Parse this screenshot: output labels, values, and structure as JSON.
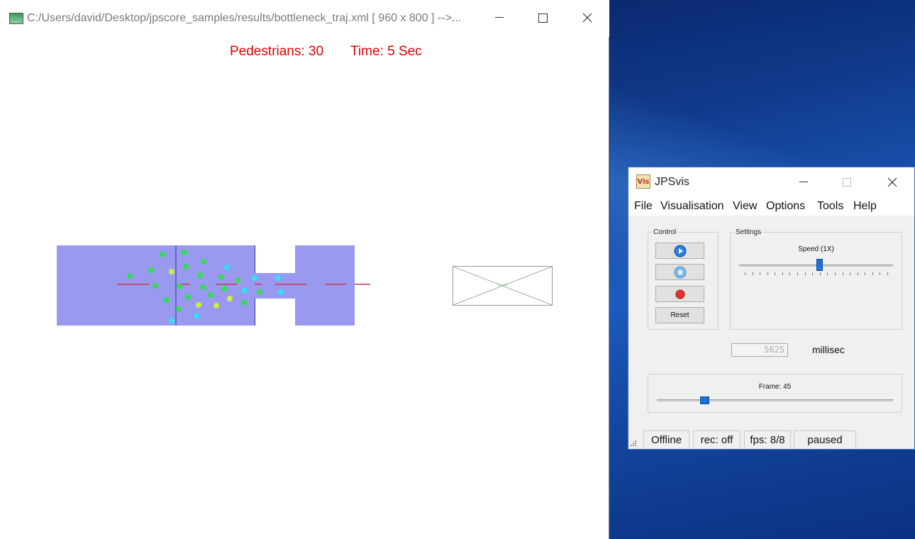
{
  "vis_window": {
    "title": "C:/Users/david/Desktop/jpscore_samples/results/bottleneck_traj.xml [ 960 x 800 ] -->...",
    "pedestrians_text": "Pedestrians: 30",
    "time_text": "Time: 5 Sec"
  },
  "jpsvis": {
    "title": "JPSvis",
    "icon_text": "Vis",
    "menu": [
      "File",
      "Visualisation",
      "View",
      "Options",
      "Tools",
      "Help"
    ],
    "control_label": "Control",
    "settings_label": "Settings",
    "speed_label": "Speed (1X)",
    "speed_position": 0.52,
    "reset_label": "Reset",
    "lcd_value": "5625",
    "lcd_unit": "millisec",
    "frame_label": "Frame: 45",
    "frame_position": 0.2,
    "status": [
      "Offline",
      "rec: off",
      "fps: 8/8",
      "paused"
    ]
  },
  "colors": {
    "room_fill": "#9999f0",
    "overlay_text": "#e00000",
    "ped_green": "#33dd55",
    "ped_yellow": "#ccee44",
    "ped_cyan": "#33e0f0"
  }
}
